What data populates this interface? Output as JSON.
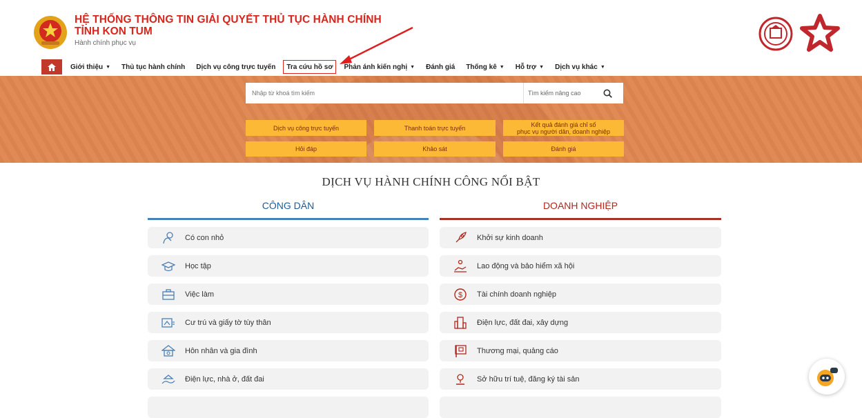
{
  "header": {
    "title_line1": "HỆ THỐNG THÔNG TIN GIẢI QUYẾT THỦ TỤC HÀNH CHÍNH",
    "title_line2": "TỈNH KON TUM",
    "subtitle": "Hành chính phục vụ"
  },
  "nav": {
    "items": [
      {
        "label": "Giới thiệu",
        "dropdown": true
      },
      {
        "label": "Thủ tục hành chính",
        "dropdown": false
      },
      {
        "label": "Dịch vụ công trực tuyến",
        "dropdown": false
      },
      {
        "label": "Tra cứu hồ sơ",
        "dropdown": false
      },
      {
        "label": "Phản ánh kiến nghị",
        "dropdown": true
      },
      {
        "label": "Đánh giá",
        "dropdown": false
      },
      {
        "label": "Thống kê",
        "dropdown": true
      },
      {
        "label": "Hỗ trợ",
        "dropdown": true
      },
      {
        "label": "Dịch vụ khác",
        "dropdown": true
      }
    ]
  },
  "search": {
    "placeholder": "Nhập từ khoá tìm kiếm",
    "advanced_label": "Tìm kiếm nâng cao"
  },
  "quick_links": {
    "online_service": "Dịch vụ công trực tuyến",
    "online_payment": "Thanh toán trực tuyến",
    "result_line1": "Kết quả đánh giá chỉ số",
    "result_line2": "phục vụ người dân, doanh nghiệp",
    "qa": "Hỏi đáp",
    "survey": "Khảo sát",
    "rating": "Đánh giá"
  },
  "section": {
    "title": "DỊCH VỤ HÀNH CHÍNH CÔNG NỔI BẬT",
    "citizen_heading": "CÔNG DÂN",
    "business_heading": "DOANH NGHIỆP",
    "citizen_items": [
      {
        "label": "Có con nhỏ",
        "icon": "baby-icon"
      },
      {
        "label": "Học tập",
        "icon": "graduation-cap-icon"
      },
      {
        "label": "Việc làm",
        "icon": "briefcase-icon"
      },
      {
        "label": "Cư trú và giấy tờ tùy thân",
        "icon": "id-card-icon"
      },
      {
        "label": "Hôn nhân và gia đình",
        "icon": "family-home-icon"
      },
      {
        "label": "Điện lực, nhà ở, đất đai",
        "icon": "house-land-icon"
      }
    ],
    "business_items": [
      {
        "label": "Khởi sự kinh doanh",
        "icon": "rocket-icon"
      },
      {
        "label": "Lao động và bảo hiểm xã hội",
        "icon": "worker-insurance-icon"
      },
      {
        "label": "Tài chính doanh nghiệp",
        "icon": "dollar-coin-icon"
      },
      {
        "label": "Điện lực, đất đai, xây dựng",
        "icon": "buildings-icon"
      },
      {
        "label": "Thương mại, quảng cáo",
        "icon": "billboard-icon"
      },
      {
        "label": "Sở hữu trí tuệ, đăng ký tài sản",
        "icon": "trophy-icon"
      }
    ]
  },
  "colors": {
    "brand_red": "#d9261c",
    "banner_orange": "#e08a56",
    "button_yellow": "#fcb935",
    "citizen_blue": "#1d5b9a",
    "business_red": "#b0271e"
  }
}
